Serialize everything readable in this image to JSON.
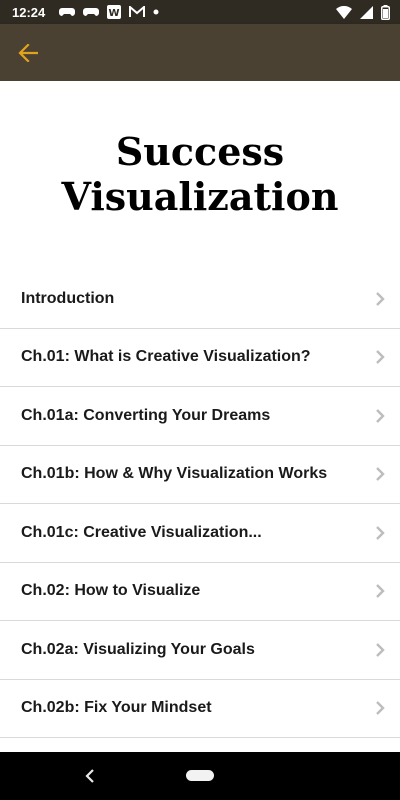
{
  "status_bar": {
    "time": "12:24",
    "notification_icons": [
      "game-controller-icon",
      "game-controller-icon",
      "w-app-icon",
      "gmail-icon",
      "dot-icon"
    ],
    "system_icons": [
      "wifi-icon",
      "signal-icon",
      "battery-icon"
    ]
  },
  "app_bar": {
    "back_icon": "arrow-left-icon",
    "accent_color": "#e0a31c",
    "background_color": "#4b4133"
  },
  "page": {
    "title_line1": "Success",
    "title_line2": "Visualization"
  },
  "chapters": [
    {
      "label": "Introduction"
    },
    {
      "label": "Ch.01: What is Creative Visualization?"
    },
    {
      "label": "Ch.01a: Converting Your Dreams"
    },
    {
      "label": "Ch.01b: How & Why Visualization Works"
    },
    {
      "label": "Ch.01c: Creative Visualization..."
    },
    {
      "label": "Ch.02: How to Visualize"
    },
    {
      "label": "Ch.02a: Visualizing Your Goals"
    },
    {
      "label": "Ch.02b: Fix Your Mindset"
    }
  ],
  "nav_bar": {
    "back_icon": "nav-back-icon",
    "home_icon": "nav-home-pill"
  }
}
